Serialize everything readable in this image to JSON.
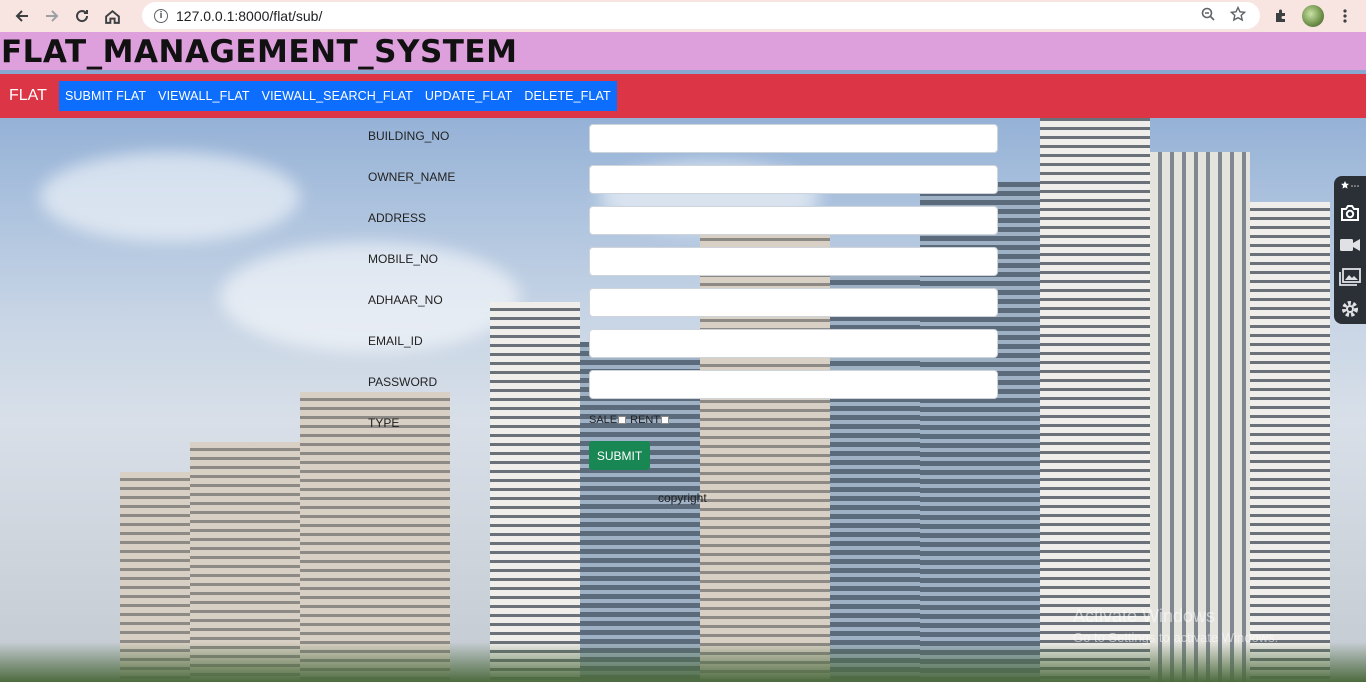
{
  "browser": {
    "url": "127.0.0.1:8000/flat/sub/",
    "icons": [
      "back-icon",
      "forward-icon",
      "reload-icon",
      "home-icon",
      "info-icon",
      "zoom-icon",
      "star-icon",
      "extensions-icon",
      "avatar",
      "menu-icon"
    ]
  },
  "header": {
    "title": "FLAT_MANAGEMENT_SYSTEM"
  },
  "navbar": {
    "brand": "FLAT",
    "links": [
      "SUBMIT FLAT",
      "VIEWALL_FLAT",
      "VIEWALL_SEARCH_FLAT",
      "UPDATE_FLAT",
      "DELETE_FLAT"
    ]
  },
  "form": {
    "fields": [
      {
        "label": "BUILDING_NO",
        "value": ""
      },
      {
        "label": "OWNER_NAME",
        "value": ""
      },
      {
        "label": "ADDRESS",
        "value": ""
      },
      {
        "label": "MOBILE_NO",
        "value": ""
      },
      {
        "label": "ADHAAR_NO",
        "value": ""
      },
      {
        "label": "EMAIL_ID",
        "value": ""
      },
      {
        "label": "PASSWORD",
        "value": ""
      }
    ],
    "type_label": "TYPE",
    "type_options": [
      "SALE",
      "RENT"
    ],
    "submit_label": "SUBMIT"
  },
  "footer": {
    "copyright": "copyright"
  },
  "side_panel": {
    "icons": [
      "star-icon",
      "camera-icon",
      "video-icon",
      "gallery-icon",
      "settings-icon"
    ]
  },
  "watermark": {
    "line1": "Activate Windows",
    "line2": "Go to Settings to activate Windows."
  },
  "colors": {
    "banner": "#dda0dd",
    "navbar": "#dc3545",
    "nav_links": "#0d6efd",
    "submit": "#198754"
  }
}
